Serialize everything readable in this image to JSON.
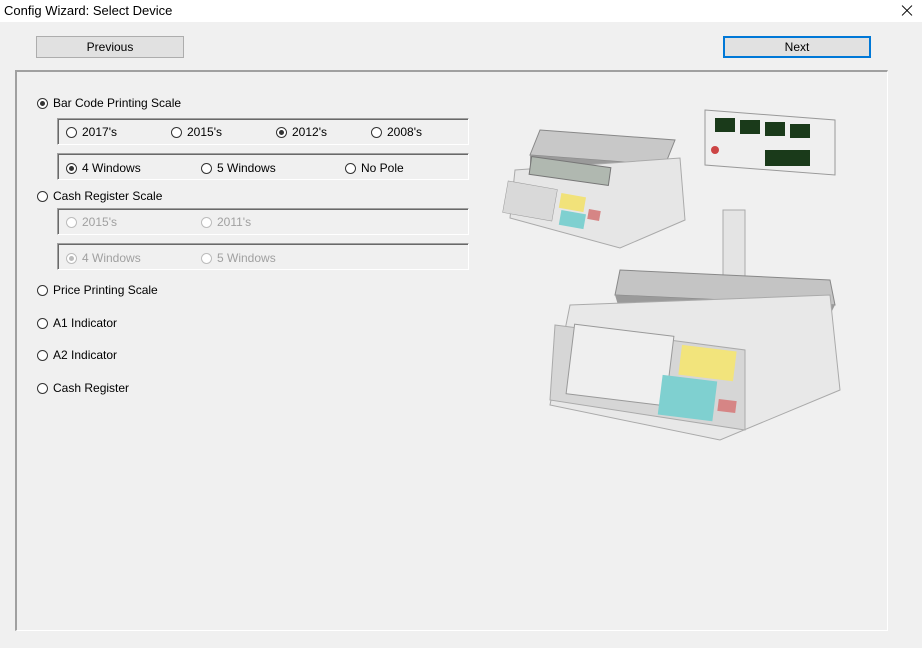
{
  "window": {
    "title": "Config Wizard: Select Device",
    "close_icon": "close-icon"
  },
  "nav": {
    "previous_label": "Previous",
    "next_label": "Next"
  },
  "devices": {
    "barcode": {
      "label": "Bar Code Printing Scale",
      "checked": true
    },
    "barcode_years": [
      "2017's",
      "2015's",
      "2012's",
      "2008's"
    ],
    "barcode_year_selected": "2012's",
    "barcode_windows": [
      "4 Windows",
      "5 Windows",
      "No Pole"
    ],
    "barcode_windows_selected": "4 Windows",
    "cash_register_scale": {
      "label": "Cash Register Scale",
      "checked": false
    },
    "crs_years": [
      "2015's",
      "2011's"
    ],
    "crs_windows": [
      "4 Windows",
      "5 Windows"
    ],
    "crs_windows_selected": "4 Windows",
    "price_printing": {
      "label": "Price Printing Scale"
    },
    "a1": {
      "label": "A1 Indicator"
    },
    "a2": {
      "label": "A2 Indicator"
    },
    "cash_register": {
      "label": "Cash Register"
    }
  },
  "image": {
    "icon": "scale-image"
  }
}
